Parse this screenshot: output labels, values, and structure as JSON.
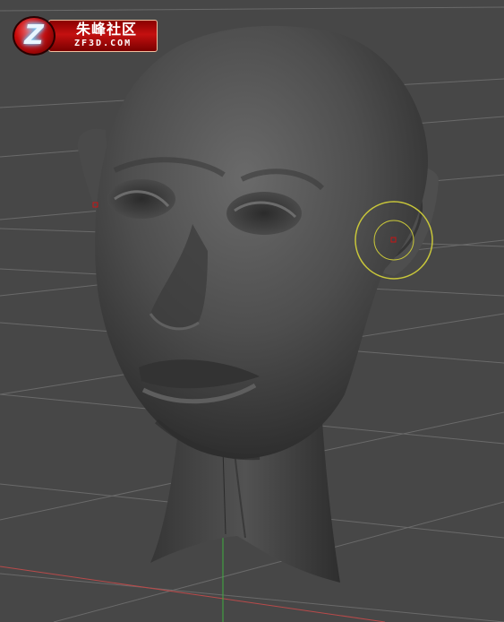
{
  "watermark": {
    "emblem_letter": "Z",
    "chinese_text": "朱峰社区",
    "latin_text": "ZF3D.COM"
  },
  "colors": {
    "background": "#474747",
    "grid_line": "#6e6e6e",
    "axis_red": "#b84a4a",
    "axis_green": "#3fae3f",
    "mesh_base": "#5a5a5a",
    "brush_ring": "#c8c63a",
    "brush_center": "#c81414"
  },
  "icons": [
    "sculpt-brush-cursor-icon",
    "vertex-marker-icon"
  ]
}
